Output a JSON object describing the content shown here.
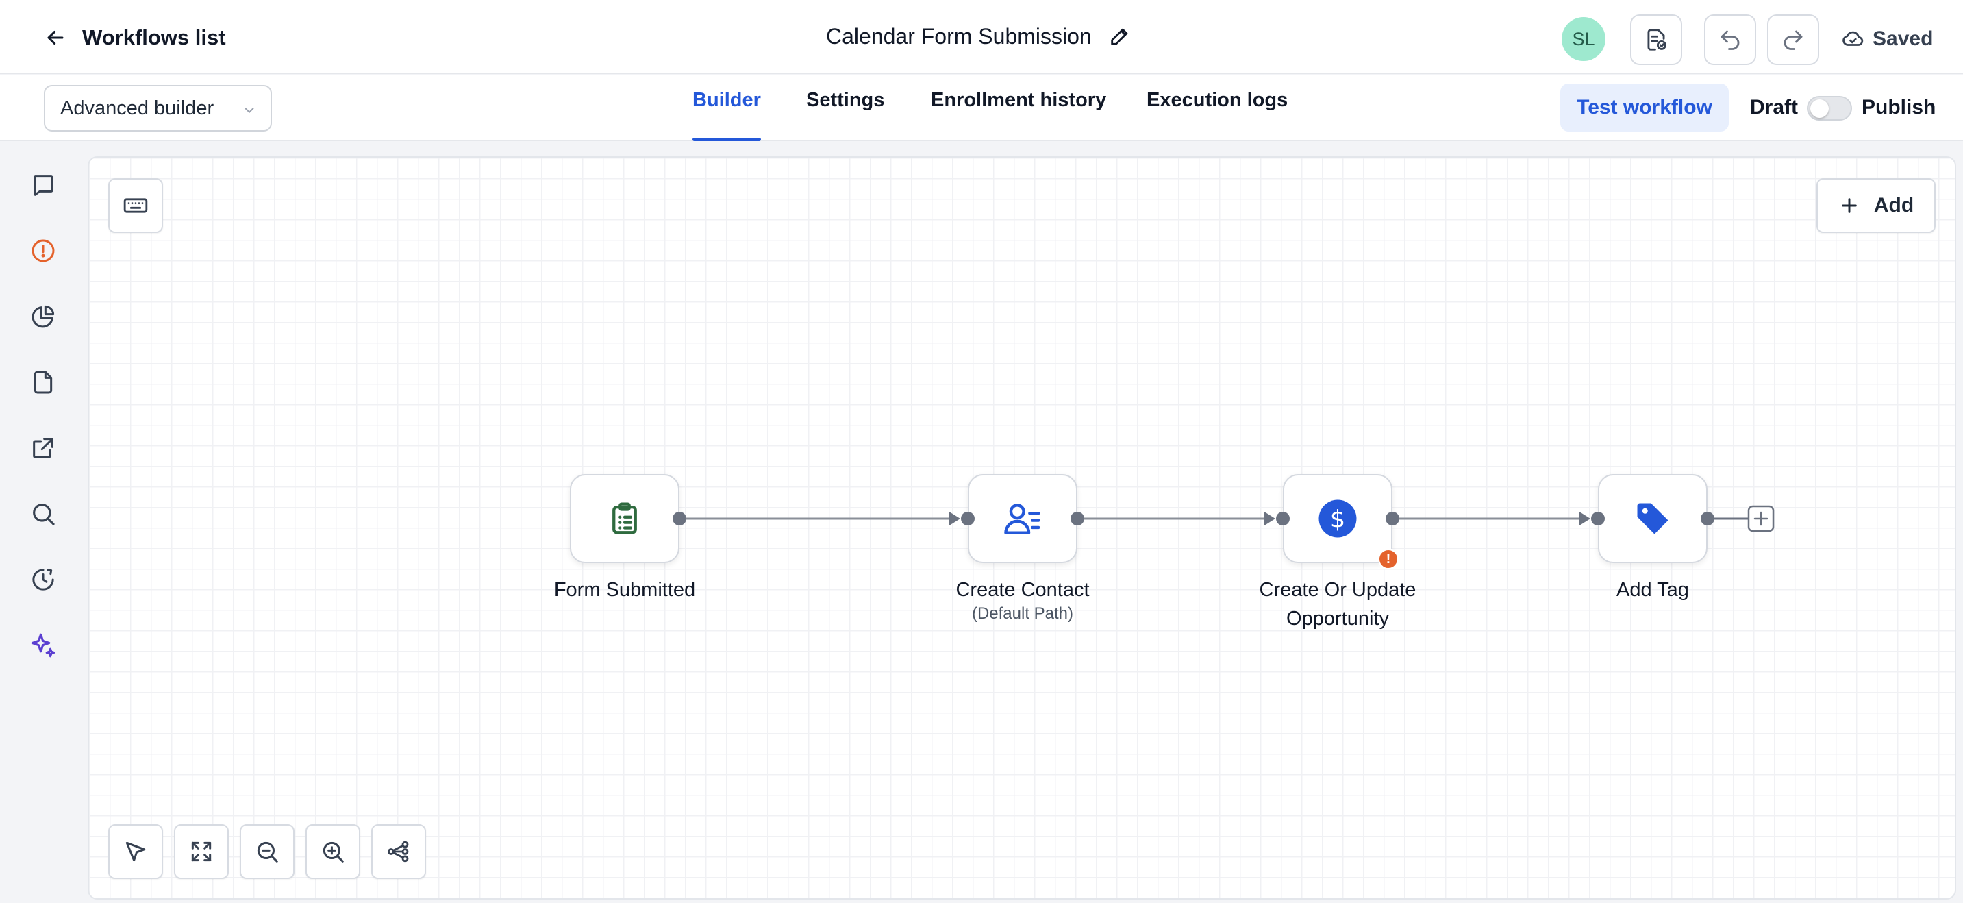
{
  "header": {
    "back_label": "Workflows list",
    "title": "Calendar Form Submission",
    "avatar_initials": "SL",
    "save_status": "Saved"
  },
  "subheader": {
    "builder_select": "Advanced builder",
    "tabs": [
      {
        "label": "Builder",
        "active": true
      },
      {
        "label": "Settings",
        "active": false
      },
      {
        "label": "Enrollment history",
        "active": false
      },
      {
        "label": "Execution logs",
        "active": false
      }
    ],
    "test_button": "Test workflow",
    "draft_label": "Draft",
    "publish_label": "Publish",
    "published": false
  },
  "sidebar": {
    "icons": [
      "chat-bubble-icon",
      "alert-circle-icon",
      "pie-chart-icon",
      "document-icon",
      "external-link-icon",
      "search-icon",
      "history-icon",
      "sparkle-icon"
    ]
  },
  "canvas": {
    "add_label": "Add",
    "nodes": [
      {
        "label": "Form Submitted",
        "sublabel": "",
        "icon": "clipboard-list-icon"
      },
      {
        "label": "Create Contact",
        "sublabel": "(Default Path)",
        "icon": "contact-icon"
      },
      {
        "label": "Create Or Update Opportunity",
        "sublabel": "",
        "icon": "dollar-icon",
        "warning": true
      },
      {
        "label": "Add Tag",
        "sublabel": "",
        "icon": "tag-icon"
      }
    ]
  },
  "colors": {
    "accent": "#2458d9",
    "form_icon": "#2f6b3f",
    "warning": "#e4622c",
    "avatar_bg": "#9ee9cf"
  }
}
